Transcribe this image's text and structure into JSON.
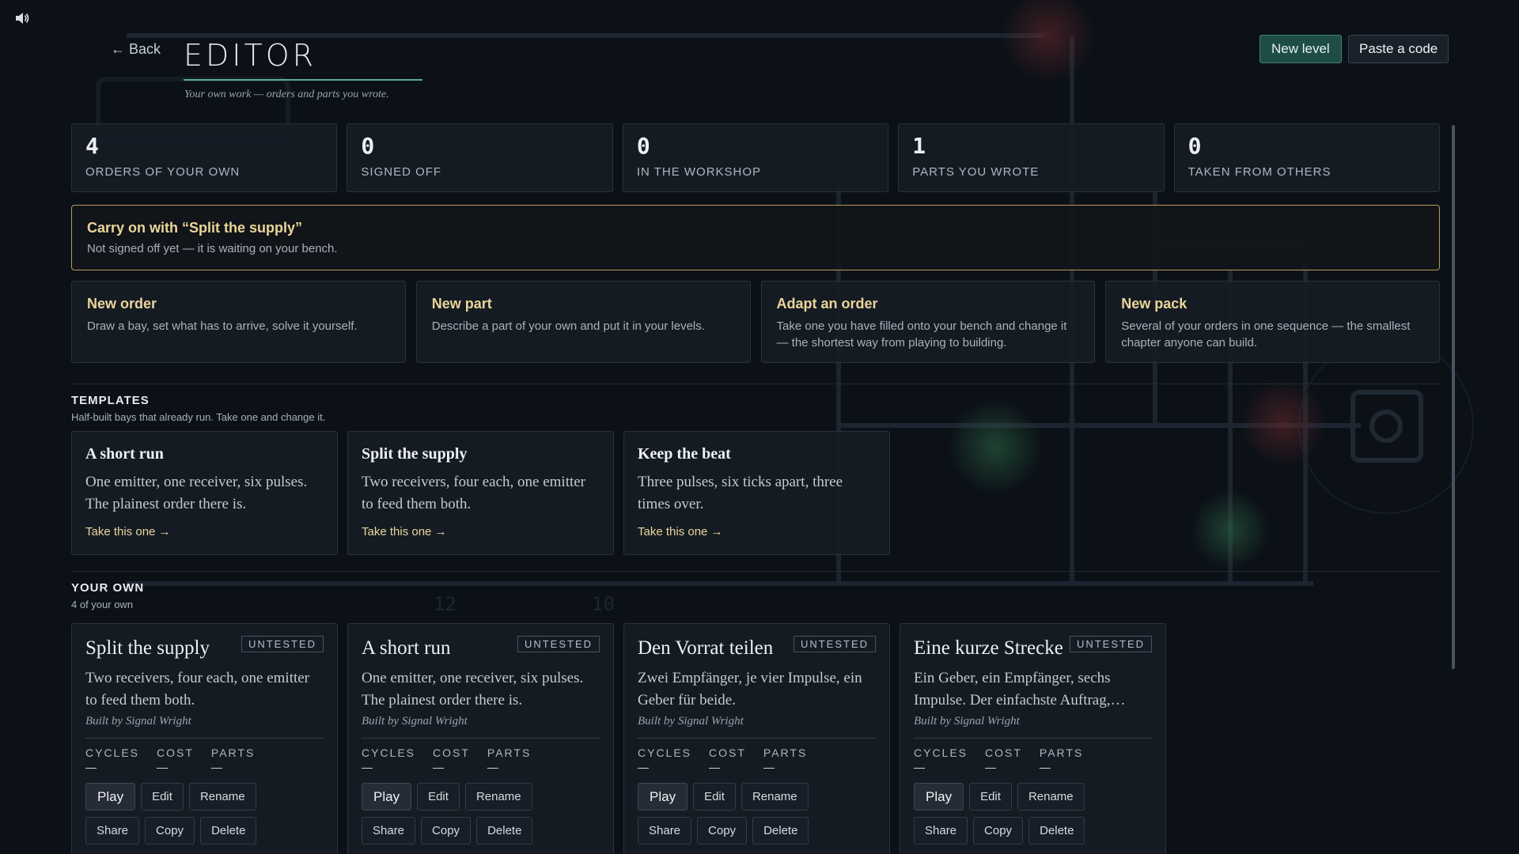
{
  "header": {
    "back_label": "← Back",
    "title": "EDITOR",
    "subtitle": "Your own work — orders and parts you wrote.",
    "new_level_label": "New level",
    "paste_label": "Paste a code"
  },
  "stats": [
    {
      "value": "4",
      "label": "ORDERS OF YOUR OWN"
    },
    {
      "value": "0",
      "label": "SIGNED OFF"
    },
    {
      "value": "0",
      "label": "IN THE WORKSHOP"
    },
    {
      "value": "1",
      "label": "PARTS YOU WROTE"
    },
    {
      "value": "0",
      "label": "TAKEN FROM OTHERS"
    }
  ],
  "carry_on": {
    "title": "Carry on with “Split the supply”",
    "subtitle": "Not signed off yet — it is waiting on your bench."
  },
  "actions": [
    {
      "title": "New order",
      "desc": "Draw a bay, set what has to arrive, solve it yourself."
    },
    {
      "title": "New part",
      "desc": "Describe a part of your own and put it in your levels."
    },
    {
      "title": "Adapt an order",
      "desc": "Take one you have filled onto your bench and change it — the shortest way from playing to building."
    },
    {
      "title": "New pack",
      "desc": "Several of your orders in one sequence — the smallest chapter anyone can build."
    }
  ],
  "templates": {
    "heading": "TEMPLATES",
    "subheading": "Half-built bays that already run. Take one and change it.",
    "items": [
      {
        "title": "A short run",
        "desc": "One emitter, one receiver, six pulses. The plainest order there is.",
        "link": "Take this one →"
      },
      {
        "title": "Split the supply",
        "desc": "Two receivers, four each, one emitter to feed them both.",
        "link": "Take this one →"
      },
      {
        "title": "Keep the beat",
        "desc": "Three pulses, six ticks apart, three times over.",
        "link": "Take this one →"
      }
    ]
  },
  "your_own": {
    "heading": "YOUR OWN",
    "subheading": "4 of your own",
    "metric_labels": {
      "cycles": "CYCLES",
      "cost": "COST",
      "parts": "PARTS"
    },
    "button_labels": {
      "play": "Play",
      "edit": "Edit",
      "rename": "Rename",
      "share": "Share",
      "copy": "Copy",
      "delete": "Delete"
    },
    "items": [
      {
        "title": "Split the supply",
        "badge": "UNTESTED",
        "desc": "Two receivers, four each, one emitter to feed them both.",
        "by": "Built by Signal Wright",
        "cycles": "—",
        "cost": "—",
        "parts": "—"
      },
      {
        "title": "A short run",
        "badge": "UNTESTED",
        "desc": "One emitter, one receiver, six pulses. The plainest order there is.",
        "by": "Built by Signal Wright",
        "cycles": "—",
        "cost": "—",
        "parts": "—"
      },
      {
        "title": "Den Vorrat teilen",
        "badge": "UNTESTED",
        "desc": "Zwei Empfänger, je vier Impulse, ein Geber für beide.",
        "by": "Built by Signal Wright",
        "cycles": "—",
        "cost": "—",
        "parts": "—"
      },
      {
        "title": "Eine kurze Strecke",
        "badge": "UNTESTED",
        "desc": "Ein Geber, ein Empfänger, sechs Impulse. Der einfachste Auftrag,…",
        "by": "Built by Signal Wright",
        "cycles": "—",
        "cost": "—",
        "parts": "—"
      }
    ]
  },
  "colors": {
    "background": "#0c1118",
    "accent_gold": "#ecd59a",
    "accent_teal": "#5fa89a",
    "new_level_bg": "#1e4d47"
  },
  "icons": {
    "sound": "speaker-icon",
    "back": "arrow-left"
  }
}
